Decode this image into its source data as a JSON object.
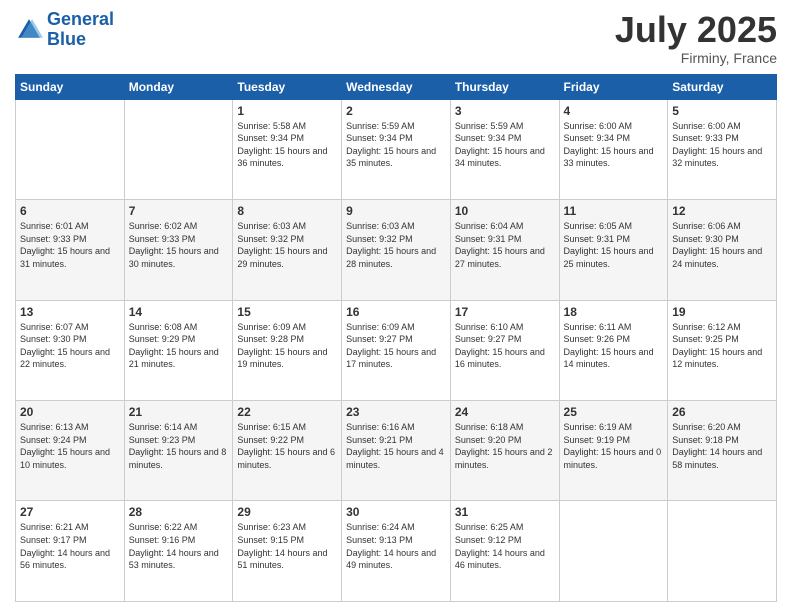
{
  "header": {
    "logo_line1": "General",
    "logo_line2": "Blue",
    "month": "July 2025",
    "location": "Firminy, France"
  },
  "days_of_week": [
    "Sunday",
    "Monday",
    "Tuesday",
    "Wednesday",
    "Thursday",
    "Friday",
    "Saturday"
  ],
  "weeks": [
    [
      {
        "day": "",
        "sunrise": "",
        "sunset": "",
        "daylight": ""
      },
      {
        "day": "",
        "sunrise": "",
        "sunset": "",
        "daylight": ""
      },
      {
        "day": "1",
        "sunrise": "Sunrise: 5:58 AM",
        "sunset": "Sunset: 9:34 PM",
        "daylight": "Daylight: 15 hours and 36 minutes."
      },
      {
        "day": "2",
        "sunrise": "Sunrise: 5:59 AM",
        "sunset": "Sunset: 9:34 PM",
        "daylight": "Daylight: 15 hours and 35 minutes."
      },
      {
        "day": "3",
        "sunrise": "Sunrise: 5:59 AM",
        "sunset": "Sunset: 9:34 PM",
        "daylight": "Daylight: 15 hours and 34 minutes."
      },
      {
        "day": "4",
        "sunrise": "Sunrise: 6:00 AM",
        "sunset": "Sunset: 9:34 PM",
        "daylight": "Daylight: 15 hours and 33 minutes."
      },
      {
        "day": "5",
        "sunrise": "Sunrise: 6:00 AM",
        "sunset": "Sunset: 9:33 PM",
        "daylight": "Daylight: 15 hours and 32 minutes."
      }
    ],
    [
      {
        "day": "6",
        "sunrise": "Sunrise: 6:01 AM",
        "sunset": "Sunset: 9:33 PM",
        "daylight": "Daylight: 15 hours and 31 minutes."
      },
      {
        "day": "7",
        "sunrise": "Sunrise: 6:02 AM",
        "sunset": "Sunset: 9:33 PM",
        "daylight": "Daylight: 15 hours and 30 minutes."
      },
      {
        "day": "8",
        "sunrise": "Sunrise: 6:03 AM",
        "sunset": "Sunset: 9:32 PM",
        "daylight": "Daylight: 15 hours and 29 minutes."
      },
      {
        "day": "9",
        "sunrise": "Sunrise: 6:03 AM",
        "sunset": "Sunset: 9:32 PM",
        "daylight": "Daylight: 15 hours and 28 minutes."
      },
      {
        "day": "10",
        "sunrise": "Sunrise: 6:04 AM",
        "sunset": "Sunset: 9:31 PM",
        "daylight": "Daylight: 15 hours and 27 minutes."
      },
      {
        "day": "11",
        "sunrise": "Sunrise: 6:05 AM",
        "sunset": "Sunset: 9:31 PM",
        "daylight": "Daylight: 15 hours and 25 minutes."
      },
      {
        "day": "12",
        "sunrise": "Sunrise: 6:06 AM",
        "sunset": "Sunset: 9:30 PM",
        "daylight": "Daylight: 15 hours and 24 minutes."
      }
    ],
    [
      {
        "day": "13",
        "sunrise": "Sunrise: 6:07 AM",
        "sunset": "Sunset: 9:30 PM",
        "daylight": "Daylight: 15 hours and 22 minutes."
      },
      {
        "day": "14",
        "sunrise": "Sunrise: 6:08 AM",
        "sunset": "Sunset: 9:29 PM",
        "daylight": "Daylight: 15 hours and 21 minutes."
      },
      {
        "day": "15",
        "sunrise": "Sunrise: 6:09 AM",
        "sunset": "Sunset: 9:28 PM",
        "daylight": "Daylight: 15 hours and 19 minutes."
      },
      {
        "day": "16",
        "sunrise": "Sunrise: 6:09 AM",
        "sunset": "Sunset: 9:27 PM",
        "daylight": "Daylight: 15 hours and 17 minutes."
      },
      {
        "day": "17",
        "sunrise": "Sunrise: 6:10 AM",
        "sunset": "Sunset: 9:27 PM",
        "daylight": "Daylight: 15 hours and 16 minutes."
      },
      {
        "day": "18",
        "sunrise": "Sunrise: 6:11 AM",
        "sunset": "Sunset: 9:26 PM",
        "daylight": "Daylight: 15 hours and 14 minutes."
      },
      {
        "day": "19",
        "sunrise": "Sunrise: 6:12 AM",
        "sunset": "Sunset: 9:25 PM",
        "daylight": "Daylight: 15 hours and 12 minutes."
      }
    ],
    [
      {
        "day": "20",
        "sunrise": "Sunrise: 6:13 AM",
        "sunset": "Sunset: 9:24 PM",
        "daylight": "Daylight: 15 hours and 10 minutes."
      },
      {
        "day": "21",
        "sunrise": "Sunrise: 6:14 AM",
        "sunset": "Sunset: 9:23 PM",
        "daylight": "Daylight: 15 hours and 8 minutes."
      },
      {
        "day": "22",
        "sunrise": "Sunrise: 6:15 AM",
        "sunset": "Sunset: 9:22 PM",
        "daylight": "Daylight: 15 hours and 6 minutes."
      },
      {
        "day": "23",
        "sunrise": "Sunrise: 6:16 AM",
        "sunset": "Sunset: 9:21 PM",
        "daylight": "Daylight: 15 hours and 4 minutes."
      },
      {
        "day": "24",
        "sunrise": "Sunrise: 6:18 AM",
        "sunset": "Sunset: 9:20 PM",
        "daylight": "Daylight: 15 hours and 2 minutes."
      },
      {
        "day": "25",
        "sunrise": "Sunrise: 6:19 AM",
        "sunset": "Sunset: 9:19 PM",
        "daylight": "Daylight: 15 hours and 0 minutes."
      },
      {
        "day": "26",
        "sunrise": "Sunrise: 6:20 AM",
        "sunset": "Sunset: 9:18 PM",
        "daylight": "Daylight: 14 hours and 58 minutes."
      }
    ],
    [
      {
        "day": "27",
        "sunrise": "Sunrise: 6:21 AM",
        "sunset": "Sunset: 9:17 PM",
        "daylight": "Daylight: 14 hours and 56 minutes."
      },
      {
        "day": "28",
        "sunrise": "Sunrise: 6:22 AM",
        "sunset": "Sunset: 9:16 PM",
        "daylight": "Daylight: 14 hours and 53 minutes."
      },
      {
        "day": "29",
        "sunrise": "Sunrise: 6:23 AM",
        "sunset": "Sunset: 9:15 PM",
        "daylight": "Daylight: 14 hours and 51 minutes."
      },
      {
        "day": "30",
        "sunrise": "Sunrise: 6:24 AM",
        "sunset": "Sunset: 9:13 PM",
        "daylight": "Daylight: 14 hours and 49 minutes."
      },
      {
        "day": "31",
        "sunrise": "Sunrise: 6:25 AM",
        "sunset": "Sunset: 9:12 PM",
        "daylight": "Daylight: 14 hours and 46 minutes."
      },
      {
        "day": "",
        "sunrise": "",
        "sunset": "",
        "daylight": ""
      },
      {
        "day": "",
        "sunrise": "",
        "sunset": "",
        "daylight": ""
      }
    ]
  ]
}
